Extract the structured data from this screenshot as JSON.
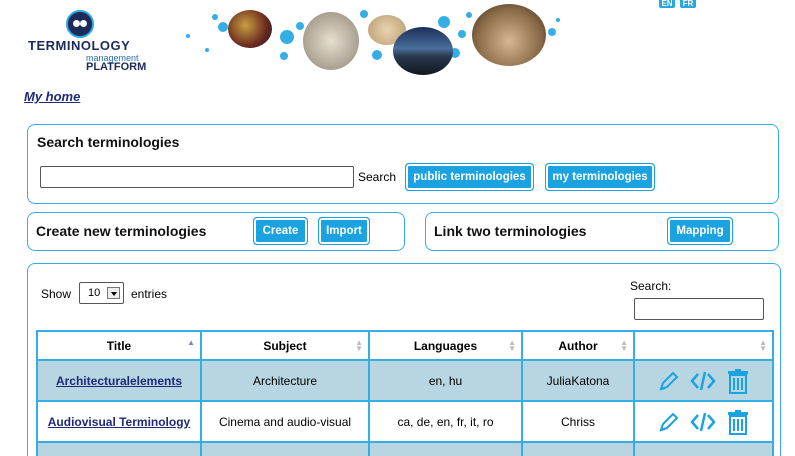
{
  "header": {
    "logo": {
      "line1": "TERMINOLOGY",
      "line2": "management",
      "line3": "PLATFORM"
    },
    "lang_en": "EN",
    "lang_fr": "FR"
  },
  "nav": {
    "my_home": "My home"
  },
  "search_panel": {
    "title": "Search terminologies",
    "input_value": "",
    "search_label": "Search",
    "public_button": "public terminologies",
    "my_button": "my terminologies"
  },
  "create_panel": {
    "title": "Create new terminologies",
    "create_button": "Create",
    "import_button": "Import"
  },
  "link_panel": {
    "title": "Link two terminologies",
    "mapping_button": "Mapping"
  },
  "table_panel": {
    "show_label": "Show",
    "entries_value": "10",
    "entries_label": "entries",
    "search_label": "Search:",
    "search_value": "",
    "columns": [
      "Title",
      "Subject",
      "Languages",
      "Author",
      ""
    ],
    "rows": [
      {
        "title": "Architecturalelements",
        "subject": "Architecture",
        "languages": "en, hu",
        "author": "JuliaKatona"
      },
      {
        "title": "Audiovisual Terminology",
        "subject": "Cinema and audio-visual",
        "languages": "ca, de, en, fr, it, ro",
        "author": "Chriss"
      }
    ],
    "row_actions": [
      "edit-icon",
      "code-icon",
      "trash-icon"
    ]
  },
  "colors": {
    "accent": "#1aa3e0",
    "border": "#35aee6",
    "row_alt": "#b8d6e2",
    "link": "#1f2a78"
  }
}
